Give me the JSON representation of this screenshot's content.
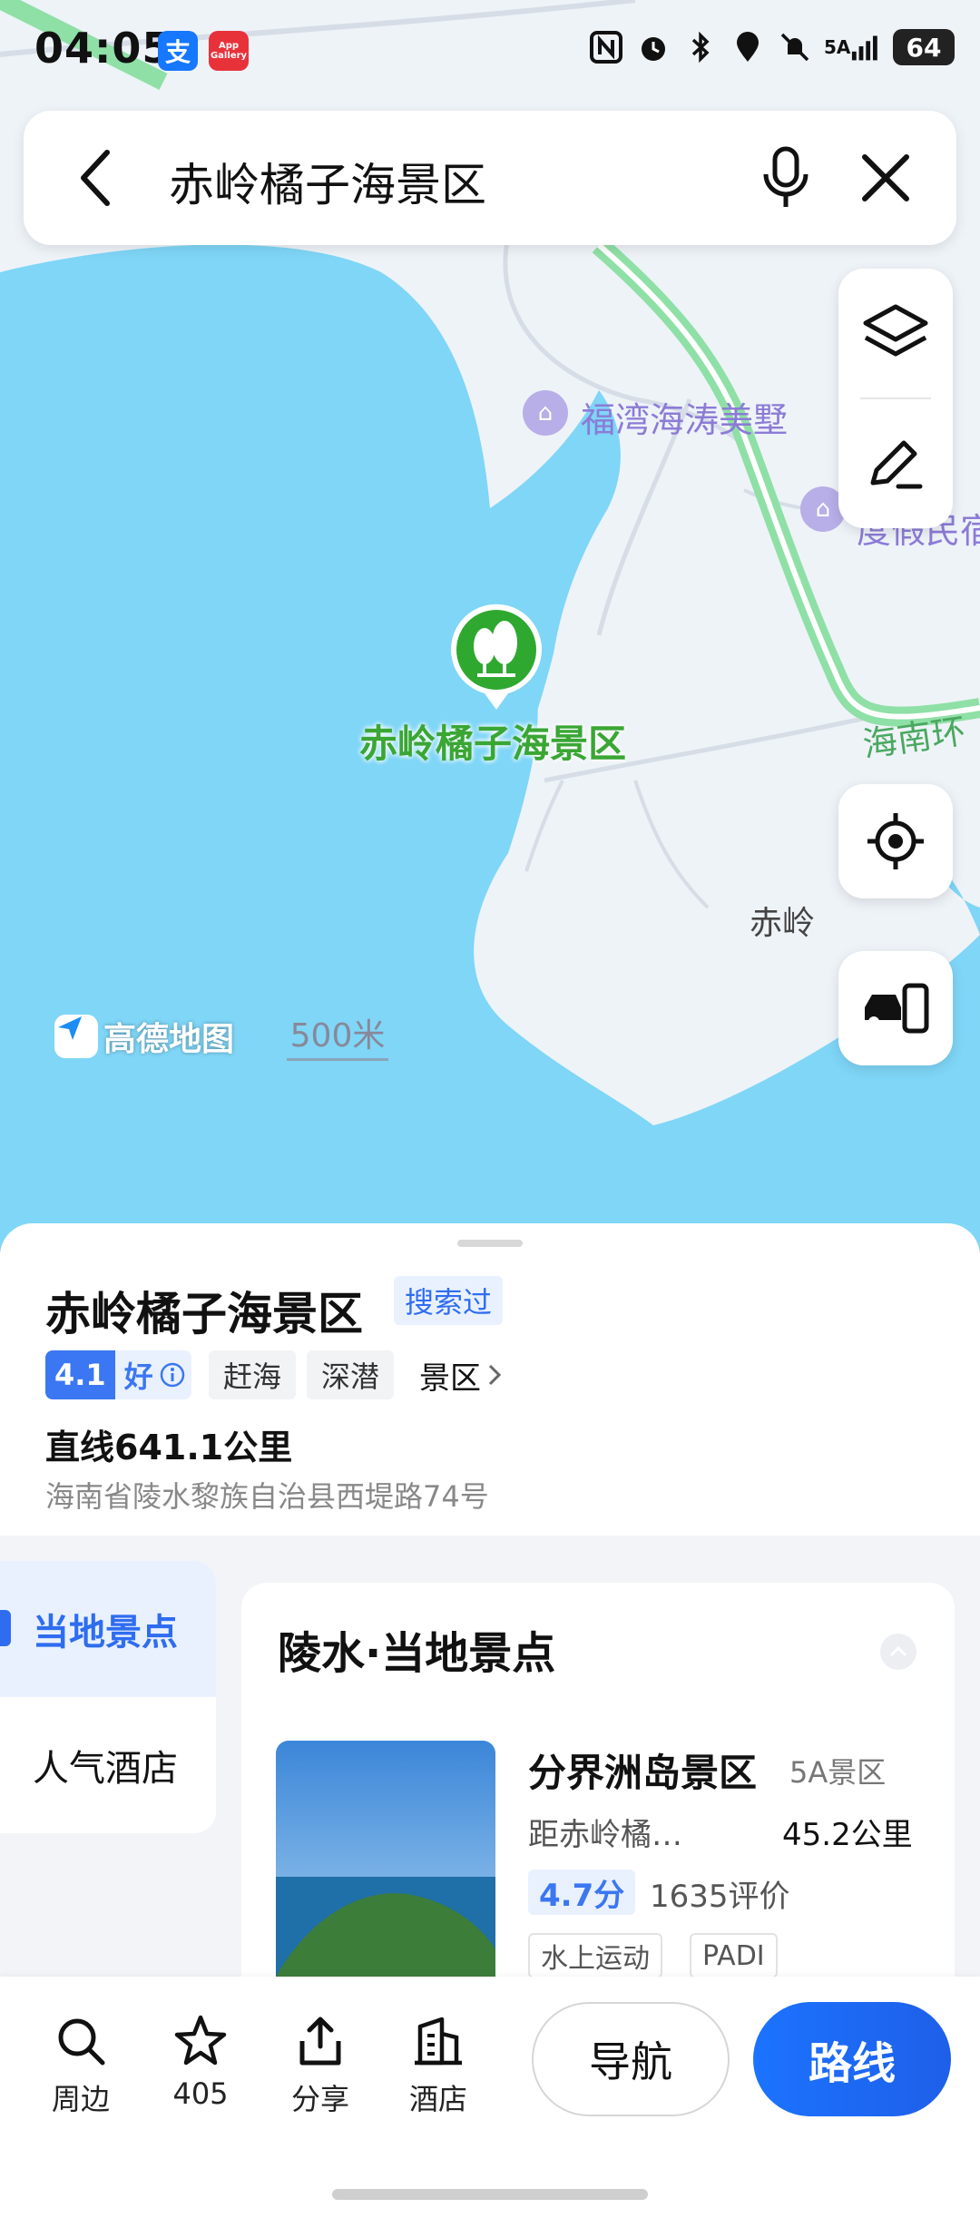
{
  "status_bar": {
    "time": "04:05",
    "signal_label": "5A",
    "battery": "64",
    "app_icons": [
      "alipay-icon",
      "app-gallery-icon"
    ],
    "alipay_glyph": "支",
    "gallery_label": "App Gallery"
  },
  "search": {
    "query": "赤岭橘子海景区",
    "icons": [
      "back-arrow-icon",
      "microphone-icon",
      "close-icon"
    ]
  },
  "map": {
    "poi_label": "赤岭橘子海景区",
    "hotel_1": "福湾海涛美墅",
    "hotel_2": "睦\n度假民宿",
    "road_label": "海南环",
    "town_label": "赤岭",
    "provider": "高德地图",
    "scale": "500米",
    "colors": {
      "water": "#7fd6f7",
      "land": "#eef3f8",
      "road_highway": "#8fe0a6",
      "poi": "#3aa634"
    }
  },
  "map_controls": [
    "layers-icon",
    "edit-note-icon",
    "locate-icon",
    "car-phone-icon"
  ],
  "place": {
    "name": "赤岭橘子海景区",
    "searched_badge": "搜索过",
    "rating": "4.1",
    "rating_word": "好",
    "tags": [
      "赶海",
      "深潜"
    ],
    "category": "景区",
    "distance": "直线641.1公里",
    "address": "海南省陵水黎族自治县西堤路74号"
  },
  "side_nav": {
    "active": "当地景点",
    "other": "人气酒店"
  },
  "nearby": {
    "title": "陵水·当地景点",
    "spot": {
      "name": "分界洲岛景区",
      "level": "5A景区",
      "from": "距赤岭橘…",
      "distance": "45.2公里",
      "rating": "4.7分",
      "reviews": "1635评价",
      "tags": [
        "水上运动",
        "PADI"
      ]
    }
  },
  "action_bar": {
    "items": [
      {
        "label": "周边",
        "icon": "search-icon"
      },
      {
        "label": "405",
        "icon": "star-icon"
      },
      {
        "label": "分享",
        "icon": "share-icon"
      },
      {
        "label": "酒店",
        "icon": "hotel-icon"
      }
    ],
    "nav_button": "导航",
    "route_button": "路线",
    "accent": "#1b73ff"
  }
}
